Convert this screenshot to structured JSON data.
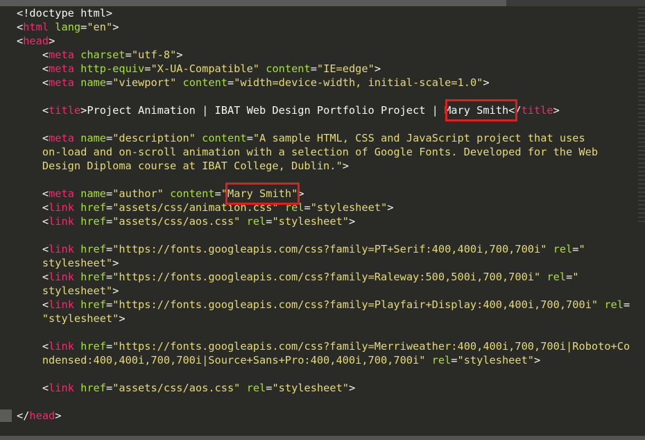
{
  "editor": {
    "theme": "monokai",
    "colors": {
      "background": "#2a2a27",
      "tag": "#f92672",
      "attribute": "#a6e22e",
      "string": "#e6db74",
      "text": "#f8f8f2",
      "highlight_box": "#e02020"
    },
    "lines": [
      [
        {
          "c": "plain",
          "t": "<!doctype html>"
        }
      ],
      [
        {
          "c": "plain",
          "t": "<"
        },
        {
          "c": "tag",
          "t": "html"
        },
        {
          "c": "plain",
          "t": " "
        },
        {
          "c": "attr",
          "t": "lang"
        },
        {
          "c": "plain",
          "t": "="
        },
        {
          "c": "str",
          "t": "\"en\""
        },
        {
          "c": "plain",
          "t": ">"
        }
      ],
      [
        {
          "c": "plain",
          "t": "<"
        },
        {
          "c": "tag",
          "t": "head"
        },
        {
          "c": "plain",
          "t": ">"
        }
      ],
      [
        {
          "c": "plain",
          "t": "    <"
        },
        {
          "c": "tag",
          "t": "meta"
        },
        {
          "c": "plain",
          "t": " "
        },
        {
          "c": "attr",
          "t": "charset"
        },
        {
          "c": "plain",
          "t": "="
        },
        {
          "c": "str",
          "t": "\"utf-8\""
        },
        {
          "c": "plain",
          "t": ">"
        }
      ],
      [
        {
          "c": "plain",
          "t": "    <"
        },
        {
          "c": "tag",
          "t": "meta"
        },
        {
          "c": "plain",
          "t": " "
        },
        {
          "c": "attr",
          "t": "http-equiv"
        },
        {
          "c": "plain",
          "t": "="
        },
        {
          "c": "str",
          "t": "\"X-UA-Compatible\""
        },
        {
          "c": "plain",
          "t": " "
        },
        {
          "c": "attr",
          "t": "content"
        },
        {
          "c": "plain",
          "t": "="
        },
        {
          "c": "str",
          "t": "\"IE=edge\""
        },
        {
          "c": "plain",
          "t": ">"
        }
      ],
      [
        {
          "c": "plain",
          "t": "    <"
        },
        {
          "c": "tag",
          "t": "meta"
        },
        {
          "c": "plain",
          "t": " "
        },
        {
          "c": "attr",
          "t": "name"
        },
        {
          "c": "plain",
          "t": "="
        },
        {
          "c": "str",
          "t": "\"viewport\""
        },
        {
          "c": "plain",
          "t": " "
        },
        {
          "c": "attr",
          "t": "content"
        },
        {
          "c": "plain",
          "t": "="
        },
        {
          "c": "str",
          "t": "\"width=device-width, initial-scale=1.0\""
        },
        {
          "c": "plain",
          "t": ">"
        }
      ],
      [],
      [
        {
          "c": "plain",
          "t": "    <"
        },
        {
          "c": "tag",
          "t": "title"
        },
        {
          "c": "plain",
          "t": ">Project Animation | IBAT Web Design Portfolio Project | Mary Smith</"
        },
        {
          "c": "tag",
          "t": "title"
        },
        {
          "c": "plain",
          "t": ">"
        }
      ],
      [],
      [
        {
          "c": "plain",
          "t": "    <"
        },
        {
          "c": "tag",
          "t": "meta"
        },
        {
          "c": "plain",
          "t": " "
        },
        {
          "c": "attr",
          "t": "name"
        },
        {
          "c": "plain",
          "t": "="
        },
        {
          "c": "str",
          "t": "\"description\""
        },
        {
          "c": "plain",
          "t": " "
        },
        {
          "c": "attr",
          "t": "content"
        },
        {
          "c": "plain",
          "t": "="
        },
        {
          "c": "str",
          "t": "\"A sample HTML, CSS and JavaScript project that uses"
        }
      ],
      [
        {
          "c": "str",
          "t": "    on-load and on-scroll animation with a selection of Google Fonts. Developed for the Web"
        }
      ],
      [
        {
          "c": "str",
          "t": "    Design Diploma course at IBAT College, Dublin.\""
        },
        {
          "c": "plain",
          "t": ">"
        }
      ],
      [],
      [
        {
          "c": "plain",
          "t": "    <"
        },
        {
          "c": "tag",
          "t": "meta"
        },
        {
          "c": "plain",
          "t": " "
        },
        {
          "c": "attr",
          "t": "name"
        },
        {
          "c": "plain",
          "t": "="
        },
        {
          "c": "str",
          "t": "\"author\""
        },
        {
          "c": "plain",
          "t": " "
        },
        {
          "c": "attr",
          "t": "content"
        },
        {
          "c": "plain",
          "t": "="
        },
        {
          "c": "str",
          "t": "\"Mary Smith\""
        },
        {
          "c": "plain",
          "t": ">"
        }
      ],
      [
        {
          "c": "plain",
          "t": "    <"
        },
        {
          "c": "tag",
          "t": "link"
        },
        {
          "c": "plain",
          "t": " "
        },
        {
          "c": "attr",
          "t": "href"
        },
        {
          "c": "plain",
          "t": "="
        },
        {
          "c": "str",
          "t": "\"assets/css/animation.css\""
        },
        {
          "c": "plain",
          "t": " "
        },
        {
          "c": "attr",
          "t": "rel"
        },
        {
          "c": "plain",
          "t": "="
        },
        {
          "c": "str",
          "t": "\"stylesheet\""
        },
        {
          "c": "plain",
          "t": ">"
        }
      ],
      [
        {
          "c": "plain",
          "t": "    <"
        },
        {
          "c": "tag",
          "t": "link"
        },
        {
          "c": "plain",
          "t": " "
        },
        {
          "c": "attr",
          "t": "href"
        },
        {
          "c": "plain",
          "t": "="
        },
        {
          "c": "str",
          "t": "\"assets/css/aos.css\""
        },
        {
          "c": "plain",
          "t": " "
        },
        {
          "c": "attr",
          "t": "rel"
        },
        {
          "c": "plain",
          "t": "="
        },
        {
          "c": "str",
          "t": "\"stylesheet\""
        },
        {
          "c": "plain",
          "t": ">"
        }
      ],
      [],
      [
        {
          "c": "plain",
          "t": "    <"
        },
        {
          "c": "tag",
          "t": "link"
        },
        {
          "c": "plain",
          "t": " "
        },
        {
          "c": "attr",
          "t": "href"
        },
        {
          "c": "plain",
          "t": "="
        },
        {
          "c": "str",
          "t": "\"https://fonts.googleapis.com/css?family=PT+Serif:400,400i,700,700i\""
        },
        {
          "c": "plain",
          "t": " "
        },
        {
          "c": "attr",
          "t": "rel"
        },
        {
          "c": "plain",
          "t": "="
        },
        {
          "c": "str",
          "t": "\""
        }
      ],
      [
        {
          "c": "str",
          "t": "    stylesheet\""
        },
        {
          "c": "plain",
          "t": ">"
        }
      ],
      [
        {
          "c": "plain",
          "t": "    <"
        },
        {
          "c": "tag",
          "t": "link"
        },
        {
          "c": "plain",
          "t": " "
        },
        {
          "c": "attr",
          "t": "href"
        },
        {
          "c": "plain",
          "t": "="
        },
        {
          "c": "str",
          "t": "\"https://fonts.googleapis.com/css?family=Raleway:500,500i,700,700i\""
        },
        {
          "c": "plain",
          "t": " "
        },
        {
          "c": "attr",
          "t": "rel"
        },
        {
          "c": "plain",
          "t": "="
        },
        {
          "c": "str",
          "t": "\""
        }
      ],
      [
        {
          "c": "str",
          "t": "    stylesheet\""
        },
        {
          "c": "plain",
          "t": ">"
        }
      ],
      [
        {
          "c": "plain",
          "t": "    <"
        },
        {
          "c": "tag",
          "t": "link"
        },
        {
          "c": "plain",
          "t": " "
        },
        {
          "c": "attr",
          "t": "href"
        },
        {
          "c": "plain",
          "t": "="
        },
        {
          "c": "str",
          "t": "\"https://fonts.googleapis.com/css?family=Playfair+Display:400,400i,700,700i\""
        },
        {
          "c": "plain",
          "t": " "
        },
        {
          "c": "attr",
          "t": "rel"
        },
        {
          "c": "plain",
          "t": "="
        }
      ],
      [
        {
          "c": "str",
          "t": "    \"stylesheet\""
        },
        {
          "c": "plain",
          "t": ">"
        }
      ],
      [],
      [
        {
          "c": "plain",
          "t": "    <"
        },
        {
          "c": "tag",
          "t": "link"
        },
        {
          "c": "plain",
          "t": " "
        },
        {
          "c": "attr",
          "t": "href"
        },
        {
          "c": "plain",
          "t": "="
        },
        {
          "c": "str",
          "t": "\"https://fonts.googleapis.com/css?family=Merriweather:400,400i,700,700i|Roboto+Co"
        }
      ],
      [
        {
          "c": "str",
          "t": "    ndensed:400,400i,700,700i|Source+Sans+Pro:400,400i,700,700i\""
        },
        {
          "c": "plain",
          "t": " "
        },
        {
          "c": "attr",
          "t": "rel"
        },
        {
          "c": "plain",
          "t": "="
        },
        {
          "c": "str",
          "t": "\"stylesheet\""
        },
        {
          "c": "plain",
          "t": ">"
        }
      ],
      [],
      [
        {
          "c": "plain",
          "t": "    <"
        },
        {
          "c": "tag",
          "t": "link"
        },
        {
          "c": "plain",
          "t": " "
        },
        {
          "c": "attr",
          "t": "href"
        },
        {
          "c": "plain",
          "t": "="
        },
        {
          "c": "str",
          "t": "\"assets/css/aos.css\""
        },
        {
          "c": "plain",
          "t": " "
        },
        {
          "c": "attr",
          "t": "rel"
        },
        {
          "c": "plain",
          "t": "="
        },
        {
          "c": "str",
          "t": "\"stylesheet\""
        },
        {
          "c": "plain",
          "t": ">"
        }
      ],
      [],
      [
        {
          "c": "plain",
          "t": "</"
        },
        {
          "c": "tag",
          "t": "head"
        },
        {
          "c": "plain",
          "t": ">"
        }
      ]
    ]
  }
}
